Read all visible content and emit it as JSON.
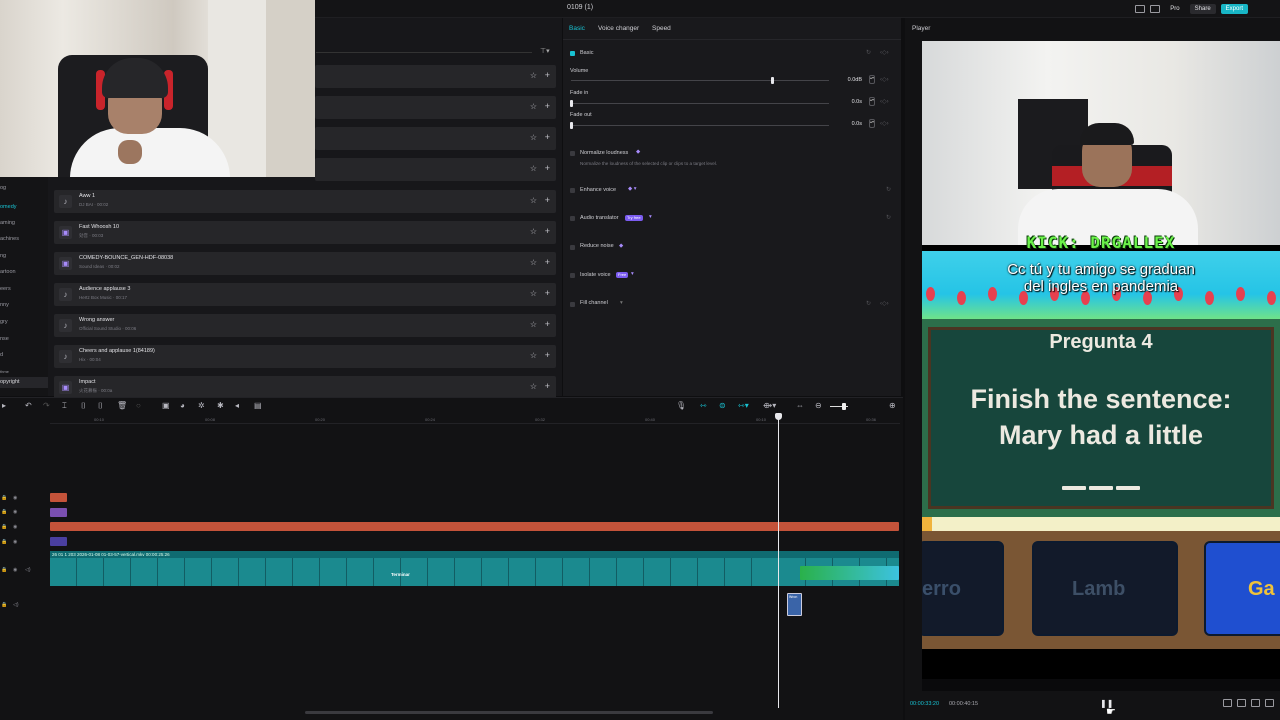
{
  "topbar": {
    "project_title": "0109 (1)",
    "pro_label": "Pro",
    "share_label": "Share",
    "export_label": "Export"
  },
  "sidebar": {
    "items": [
      "og",
      "omedy",
      "aming",
      "achines",
      "ng",
      "artoon",
      "eers",
      "nny",
      "gry",
      "nse",
      "d",
      "thme",
      "opyright"
    ],
    "active_index": 1,
    "selected_index": 12
  },
  "audio_list": {
    "items": [
      {
        "name": "Aww 1",
        "sub": "DJ BAI · 00:02",
        "icon": "note-icon"
      },
      {
        "name": "Fast Whoosh 10",
        "sub": "効音 · 00:03",
        "icon": "sfx-icon"
      },
      {
        "name": "COMEDY-BOUNCE_GEN-HDF-08038",
        "sub": "Sound Ideas · 00:02",
        "icon": "sfx-icon"
      },
      {
        "name": "Audience applause 3",
        "sub": "Hertz Box Music · 00:17",
        "icon": "note-icon"
      },
      {
        "name": "Wrong answer",
        "sub": "Official Sound Studio · 00:06",
        "icon": "note-icon"
      },
      {
        "name": "Cheers and applause 1(84189)",
        "sub": "Hix · 00:04",
        "icon": "note-icon"
      },
      {
        "name": "Impact",
        "sub": "火花慕振 · 00:0a",
        "icon": "sfx-icon"
      }
    ]
  },
  "properties": {
    "tabs": [
      "Basic",
      "Voice changer",
      "Speed"
    ],
    "active_tab": 0,
    "section_title": "Basic",
    "volume_label": "Volume",
    "volume_value": "0.0dB",
    "volume_level": 0.78,
    "fade_in_label": "Fade in",
    "fade_in_value": "0.0s",
    "fade_out_label": "Fade out",
    "fade_out_value": "0.0s",
    "normalize_label": "Normalize loudness",
    "normalize_desc": "Normalize the loudness of the selected clip or clips to a target level.",
    "enhance_label": "Enhance voice",
    "translator_label": "Audio translator",
    "translator_badge": "Try free",
    "reduce_label": "Reduce noise",
    "isolate_label": "Isolate voice",
    "isolate_badge": "Free",
    "fill_label": "Fill channel"
  },
  "player": {
    "label": "Player",
    "kick_text": "KICK: DRGALLEX",
    "caption_line1": "Cc tú y tu amigo se graduan",
    "caption_line2": "del ingles en pandemia",
    "question_title": "Pregunta 4",
    "question_line1": "Finish the sentence:",
    "question_line2": "Mary had a little",
    "answers": [
      "erro",
      "Lamb",
      "Ga"
    ],
    "time_current": "00:00:33:20",
    "time_total": "00:00:40:15"
  },
  "timeline": {
    "ticks": [
      "00:10",
      "00:08",
      "00:20",
      "00:24",
      "00:32",
      "00:40",
      "00:10",
      "00:36"
    ],
    "main_clip_label": "26 01 1   203   2026-01-08 01-03-57-vertical.mkv   00:00:25:26",
    "terminar_label": "Terminar",
    "sticker_label": "Wron"
  },
  "colors": {
    "accent": "#18c2d2",
    "clip_orange": "#c4533a",
    "clip_purple": "#7a4fb0",
    "clip_teal": "#1b8a8f"
  }
}
